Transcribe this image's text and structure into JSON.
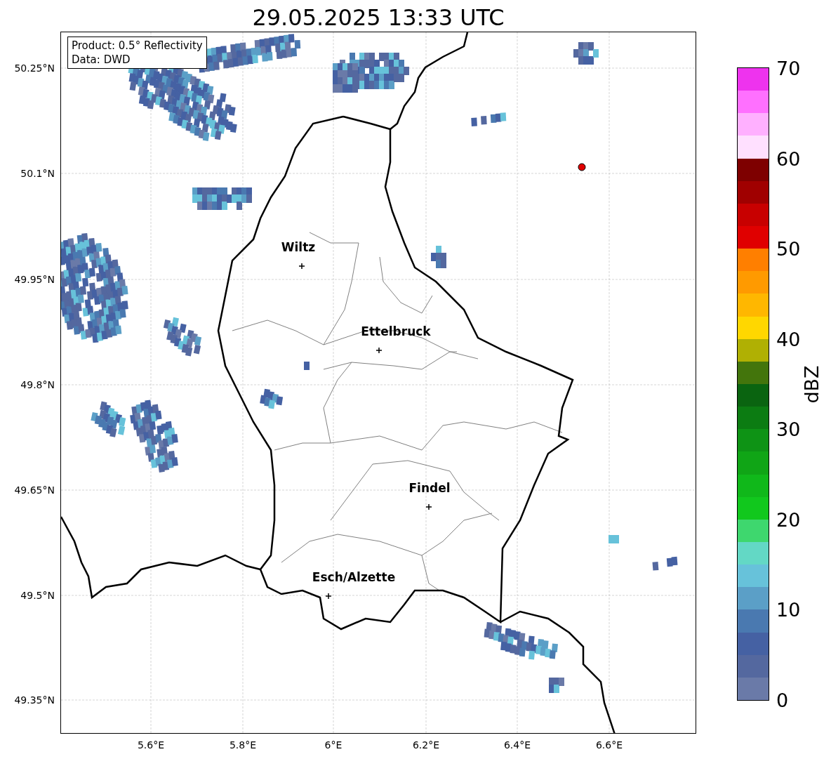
{
  "title": "29.05.2025 13:33 UTC",
  "info_box": {
    "lines": [
      "Product: 0.5° Reflectivity",
      "Data: DWD"
    ]
  },
  "map": {
    "lat_ticks": [
      {
        "label": "50.25°N"
      },
      {
        "label": "50.1°N"
      },
      {
        "label": "49.95°N"
      },
      {
        "label": "49.8°N"
      },
      {
        "label": "49.65°N"
      },
      {
        "label": "49.5°N"
      },
      {
        "label": "49.35°N"
      }
    ],
    "lon_ticks": [
      {
        "label": "5.6°E"
      },
      {
        "label": "5.8°E"
      },
      {
        "label": "6°E"
      },
      {
        "label": "6.2°E"
      },
      {
        "label": "6.4°E"
      },
      {
        "label": "6.6°E"
      }
    ],
    "cities": [
      {
        "name": "Wiltz"
      },
      {
        "name": "Ettelbruck"
      },
      {
        "name": "Findel"
      },
      {
        "name": "Esch/Alzette"
      }
    ]
  },
  "colorbar": {
    "label": "dBZ",
    "ticks": [
      "70",
      "60",
      "50",
      "40",
      "30",
      "20",
      "10",
      "0"
    ],
    "segments": [
      {
        "color": "#ee33ee"
      },
      {
        "color": "#ff70ff"
      },
      {
        "color": "#ffb0ff"
      },
      {
        "color": "#ffe0ff"
      },
      {
        "color": "#7e0000"
      },
      {
        "color": "#a00000"
      },
      {
        "color": "#c80000"
      },
      {
        "color": "#e00000"
      },
      {
        "color": "#ff7f00"
      },
      {
        "color": "#ff9a00"
      },
      {
        "color": "#ffb700"
      },
      {
        "color": "#ffd700"
      },
      {
        "color": "#b0b003"
      },
      {
        "color": "#43750c"
      },
      {
        "color": "#0a6410"
      },
      {
        "color": "#0c7c12"
      },
      {
        "color": "#0e9315"
      },
      {
        "color": "#10a516"
      },
      {
        "color": "#10b81a"
      },
      {
        "color": "#11c81d"
      },
      {
        "color": "#3ed76e"
      },
      {
        "color": "#63d8c5"
      },
      {
        "color": "#67c2da"
      },
      {
        "color": "#5b9fc7"
      },
      {
        "color": "#4a79b0"
      },
      {
        "color": "#4561a3"
      },
      {
        "color": "#54689f"
      },
      {
        "color": "#6a7aa8"
      }
    ]
  }
}
